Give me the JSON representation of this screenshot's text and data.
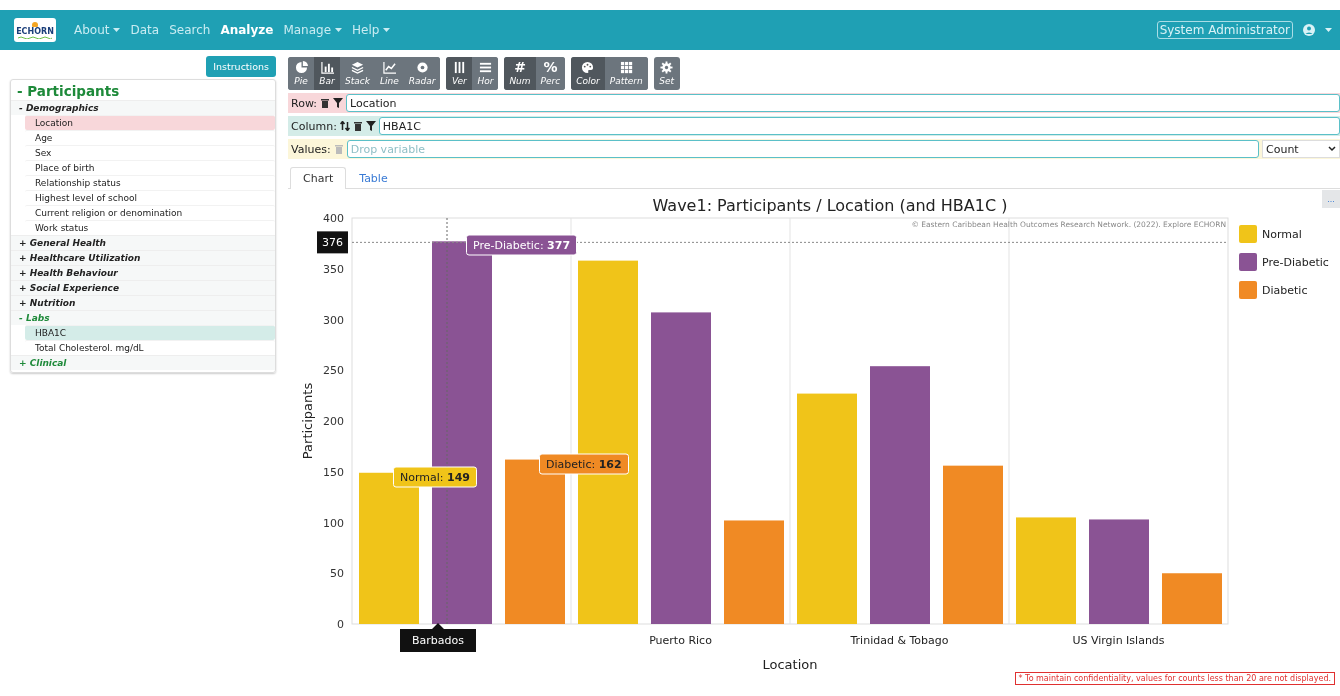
{
  "navbar": {
    "logo": "ECHORN",
    "menu": [
      {
        "label": "About",
        "dropdown": true,
        "selected": false
      },
      {
        "label": "Data",
        "dropdown": false,
        "selected": false
      },
      {
        "label": "Search",
        "dropdown": false,
        "selected": false
      },
      {
        "label": "Analyze",
        "dropdown": false,
        "selected": true
      },
      {
        "label": "Manage",
        "dropdown": true,
        "selected": false
      },
      {
        "label": "Help",
        "dropdown": true,
        "selected": false
      }
    ],
    "user": "System Administrator"
  },
  "sidebar": {
    "instructions_button": "Instructions",
    "tree": {
      "label": "Participants",
      "toggle": "-",
      "children": [
        {
          "label": "Demographics",
          "toggle": "-",
          "color": "#222222",
          "children": [
            {
              "label": "Location",
              "selected": true,
              "color": "#f8d7da"
            },
            {
              "label": "Age",
              "selected": false
            },
            {
              "label": "Sex",
              "selected": false
            },
            {
              "label": "Place of birth",
              "selected": false
            },
            {
              "label": "Relationship status",
              "selected": false
            },
            {
              "label": "Highest level of school",
              "selected": false
            },
            {
              "label": "Current religion or denomination",
              "selected": false
            },
            {
              "label": "Work status",
              "selected": false
            }
          ]
        },
        {
          "label": "General Health",
          "toggle": "+",
          "color": "#222222"
        },
        {
          "label": "Healthcare Utilization",
          "toggle": "+",
          "color": "#222222"
        },
        {
          "label": "Health Behaviour",
          "toggle": "+",
          "color": "#222222"
        },
        {
          "label": "Social Experience",
          "toggle": "+",
          "color": "#222222"
        },
        {
          "label": "Nutrition",
          "toggle": "+",
          "color": "#222222"
        },
        {
          "label": "Labs",
          "toggle": "-",
          "color": "#1e8a3a",
          "children": [
            {
              "label": "HBA1C",
              "selected": true,
              "color": "#d4ece8"
            },
            {
              "label": "Total Cholesterol. mg/dL",
              "selected": false
            }
          ]
        },
        {
          "label": "Clinical",
          "toggle": "+",
          "color": "#1e8a3a"
        }
      ]
    }
  },
  "toolbar": [
    [
      {
        "label": "Pie",
        "selected": false
      },
      {
        "label": "Bar",
        "selected": true
      },
      {
        "label": "Stack",
        "selected": false
      },
      {
        "label": "Line",
        "selected": false
      },
      {
        "label": "Radar",
        "selected": false
      }
    ],
    [
      {
        "label": "Ver",
        "selected": true
      },
      {
        "label": "Hor",
        "selected": false
      }
    ],
    [
      {
        "label": "Num",
        "glyph": "#",
        "selected": true
      },
      {
        "label": "Perc",
        "glyph": "%",
        "selected": false
      }
    ],
    [
      {
        "label": "Color",
        "selected": true
      },
      {
        "label": "Pattern",
        "selected": false
      }
    ],
    [
      {
        "label": "Set",
        "selected": false
      }
    ]
  ],
  "drop_zones": [
    {
      "kind": "row",
      "label": "Row:",
      "value": "Location",
      "sortable": false,
      "filterable": true
    },
    {
      "kind": "column",
      "label": "Column:",
      "value": "HBA1C",
      "sortable": true,
      "filterable": true
    },
    {
      "kind": "values",
      "label": "Values:",
      "placeholder": "Drop variable",
      "sortable": false,
      "filterable": false,
      "aggregate": "Count"
    }
  ],
  "tabs": [
    {
      "label": "Chart",
      "selected": true
    },
    {
      "label": "Table",
      "selected": false
    }
  ],
  "chart": {
    "menu_button": "...",
    "credit": "© Eastern Caribbean Health Outcomes Research Network. (2022). Explore ECHORN",
    "chart_data": {
      "type": "bar",
      "title": "Wave1: Participants / Location (and HBA1C )",
      "xlabel": "Location",
      "ylabel": "Participants",
      "categories": [
        "Barbados",
        "Puerto Rico",
        "Trinidad & Tobago",
        "US Virgin Islands"
      ],
      "series": [
        {
          "name": "Normal",
          "color": "#f0c419",
          "values": [
            149,
            358,
            227,
            105
          ]
        },
        {
          "name": "Pre-Diabetic",
          "color": "#8a5394",
          "values": [
            377,
            307,
            254,
            103
          ]
        },
        {
          "name": "Diabetic",
          "color": "#f08a24",
          "values": [
            162,
            102,
            156,
            50
          ]
        }
      ],
      "legend": "right",
      "ref_lines": [
        {
          "axis": "y",
          "value": 376,
          "label": "376"
        },
        {
          "axis": "x",
          "value": "Barbados"
        }
      ],
      "ylim": [
        0,
        400
      ],
      "yticks": [
        0,
        50,
        100,
        150,
        200,
        250,
        300,
        350,
        400
      ]
    },
    "hover": {
      "category_selected": [
        true,
        false,
        false,
        false
      ],
      "tooltips": [
        "Normal: **149**",
        "Pre-Diabetic: **377**",
        "Diabetic: **162**"
      ]
    },
    "note": "* To maintain confidentiality, values for counts less than 20 are not displayed."
  }
}
